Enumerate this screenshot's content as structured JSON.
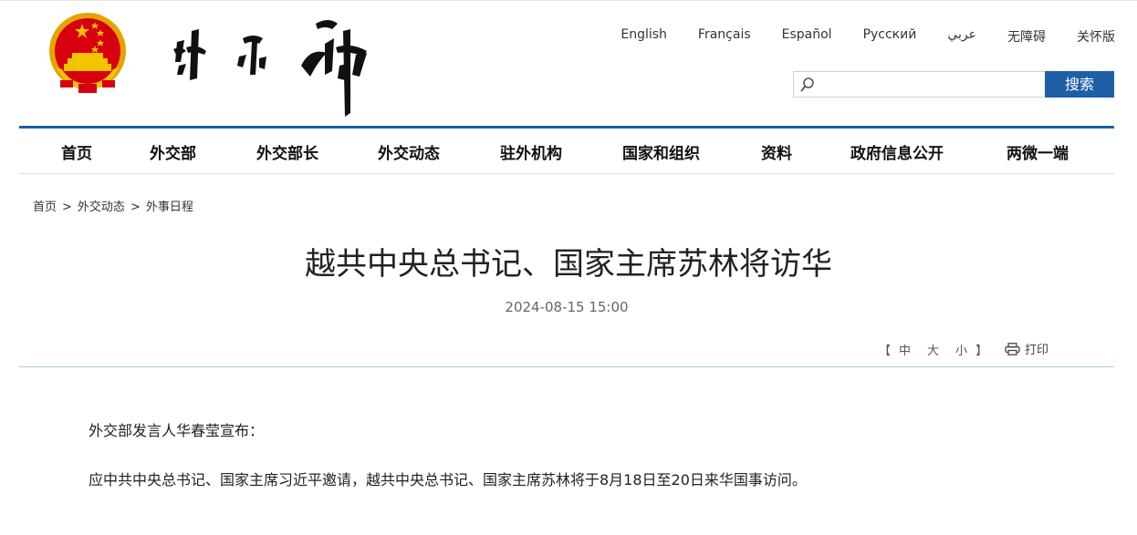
{
  "header": {
    "languages": [
      "English",
      "Français",
      "Español",
      "Русский",
      "عربي",
      "无障碍",
      "关怀版"
    ],
    "search": {
      "placeholder": "",
      "value": "",
      "button_label": "搜索"
    }
  },
  "nav": {
    "items": [
      "首页",
      "外交部",
      "外交部长",
      "外交动态",
      "驻外机构",
      "国家和组织",
      "资料",
      "政府信息公开",
      "两微一端"
    ]
  },
  "breadcrumb": {
    "items": [
      "首页",
      "外交动态",
      "外事日程"
    ],
    "separator": ">"
  },
  "article": {
    "title": "越共中央总书记、国家主席苏林将访华",
    "date": "2024-08-15 15:00",
    "font_size_controls": {
      "open": "【",
      "options": [
        "中",
        "大",
        "小"
      ],
      "close": "】"
    },
    "print_label": "打印",
    "paragraphs": [
      "外交部发言人华春莹宣布：",
      "应中共中央总书记、国家主席习近平邀请，越共中央总书记、国家主席苏林将于8月18日至20日来华国事访问。"
    ]
  },
  "colors": {
    "accent": "#1e5fa7",
    "divider": "#a9cfe0",
    "emblem_red": "#d7000f",
    "emblem_gold": "#f5c400"
  },
  "icons": [
    "national-emblem",
    "search-icon",
    "printer-icon"
  ]
}
